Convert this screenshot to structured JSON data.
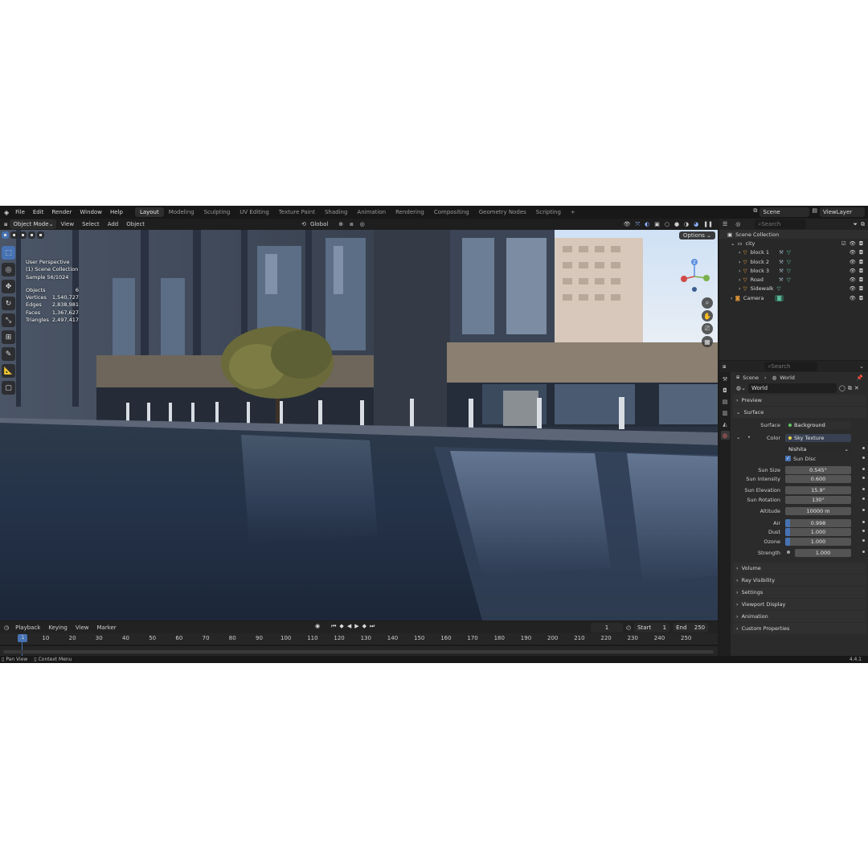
{
  "topbar": {
    "menus": [
      "File",
      "Edit",
      "Render",
      "Window",
      "Help"
    ],
    "workspaces": [
      "Layout",
      "Modeling",
      "Sculpting",
      "UV Editing",
      "Texture Paint",
      "Shading",
      "Animation",
      "Rendering",
      "Compositing",
      "Geometry Nodes",
      "Scripting"
    ],
    "active_workspace": "Layout",
    "add_tab": "+",
    "scene": "Scene",
    "view_layer": "ViewLayer"
  },
  "viewport": {
    "mode": "Object Mode",
    "menus": [
      "View",
      "Select",
      "Add",
      "Object"
    ],
    "orientation": "Global",
    "options_label": "Options",
    "overlay": {
      "perspective": "User Perspective",
      "collection": "(1) Scene Collection",
      "sample": "Sample 56/1024",
      "stats": [
        {
          "label": "Objects",
          "value": "6"
        },
        {
          "label": "Vertices",
          "value": "1,540,727"
        },
        {
          "label": "Edges",
          "value": "2,838,981"
        },
        {
          "label": "Faces",
          "value": "1,367,627"
        },
        {
          "label": "Triangles",
          "value": "2,497,417"
        }
      ]
    },
    "gizmo_label": "Z"
  },
  "timeline": {
    "menus": [
      "Playback",
      "Keying",
      "View",
      "Marker"
    ],
    "current_frame": "1",
    "start_label": "Start",
    "start": "1",
    "end_label": "End",
    "end": "250",
    "ruler": [
      "10",
      "20",
      "30",
      "40",
      "50",
      "60",
      "70",
      "80",
      "90",
      "100",
      "110",
      "120",
      "130",
      "140",
      "150",
      "160",
      "170",
      "180",
      "190",
      "200",
      "210",
      "220",
      "230",
      "240",
      "250"
    ],
    "ruler_current": "1"
  },
  "statusbar": {
    "pan": "Pan View",
    "context": "Context Menu",
    "version": "4.4.1"
  },
  "outliner": {
    "search_placeholder": "Search",
    "root": "Scene Collection",
    "items": [
      {
        "name": "city",
        "level": 1
      },
      {
        "name": "block 1",
        "level": 2
      },
      {
        "name": "block 2",
        "level": 2
      },
      {
        "name": "block 3",
        "level": 2
      },
      {
        "name": "Road",
        "level": 2
      },
      {
        "name": "Sidewalk",
        "level": 2
      },
      {
        "name": "Camera",
        "level": 1
      }
    ]
  },
  "properties": {
    "search_placeholder": "Search",
    "breadcrumb": [
      "Scene",
      "World"
    ],
    "world_name": "World",
    "panels": {
      "preview": "Preview",
      "surface": "Surface",
      "volume": "Volume",
      "ray_visibility": "Ray Visibility",
      "settings": "Settings",
      "viewport_display": "Viewport Display",
      "animation": "Animation",
      "custom_properties": "Custom Properties"
    },
    "surface": {
      "surface_label": "Surface",
      "surface_value": "Background",
      "color_label": "Color",
      "color_value": "Sky Texture",
      "sky_type": "Nishita",
      "sun_disc_label": "Sun Disc",
      "sun_size_label": "Sun Size",
      "sun_size": "0.545°",
      "sun_intensity_label": "Sun Intensity",
      "sun_intensity": "0.600",
      "sun_elevation_label": "Sun Elevation",
      "sun_elevation": "15.9°",
      "sun_rotation_label": "Sun Rotation",
      "sun_rotation": "130°",
      "altitude_label": "Altitude",
      "altitude": "10000 m",
      "air_label": "Air",
      "air": "0.998",
      "air_fraction": 0.998,
      "dust_label": "Dust",
      "dust": "1.000",
      "dust_fraction": 1.0,
      "ozone_label": "Ozone",
      "ozone": "1.000",
      "ozone_fraction": 1.0,
      "strength_label": "Strength",
      "strength": "1.000"
    }
  },
  "colors": {
    "accent": "#4772b3",
    "object_orange": "#e69a3a",
    "mesh_green": "#63c7a8",
    "world_red": "#d05050"
  }
}
